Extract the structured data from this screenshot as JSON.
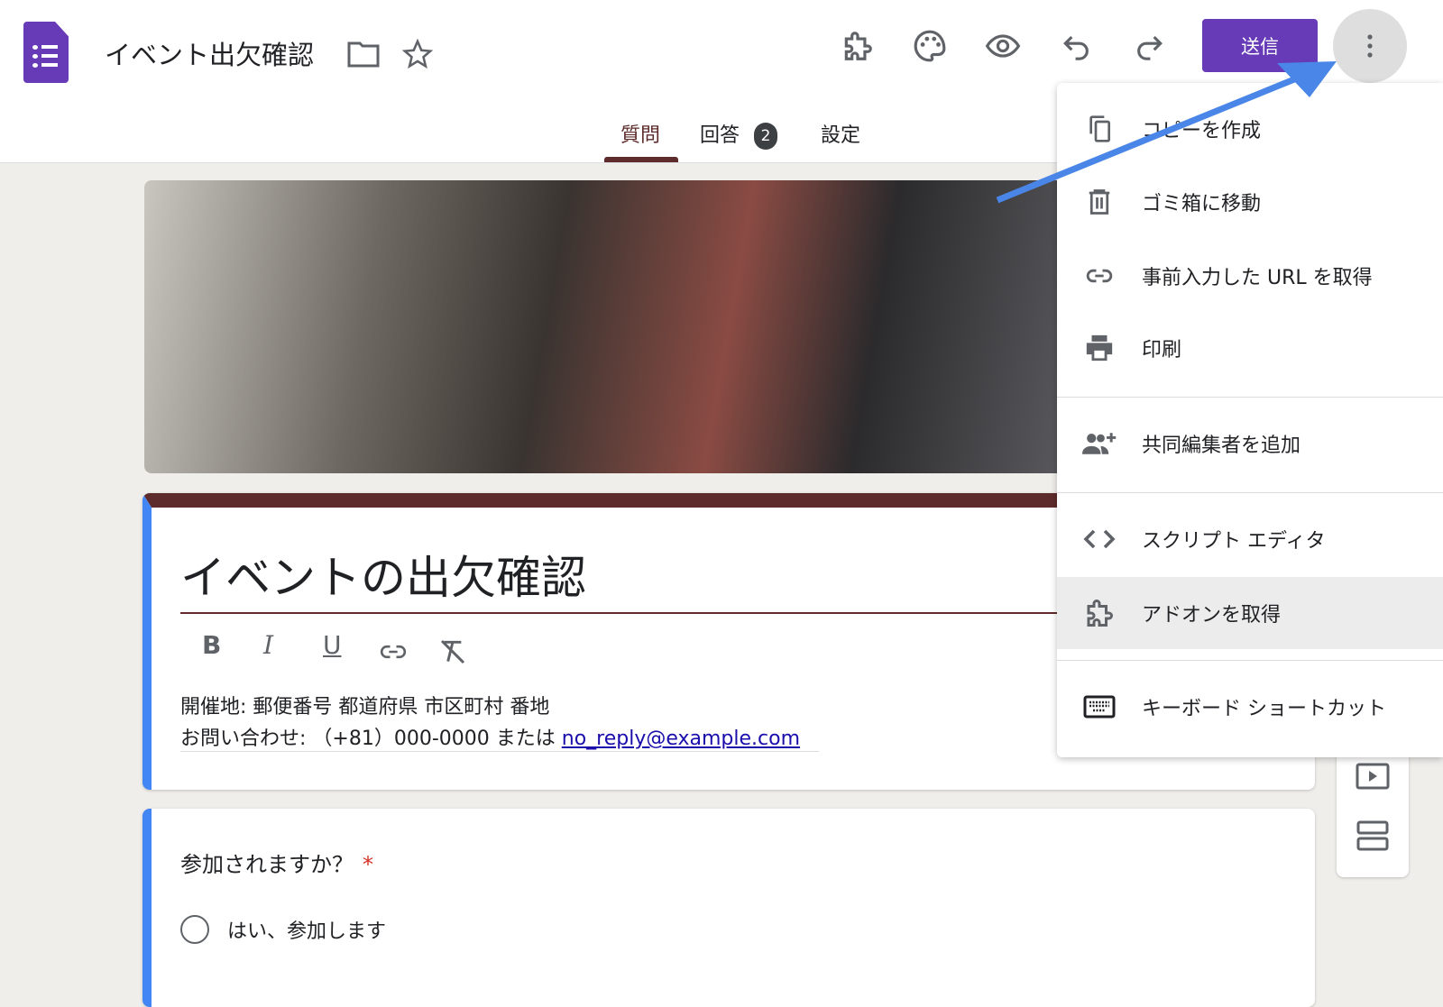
{
  "header": {
    "doc_title": "イベント出欠確認",
    "send_label": "送信"
  },
  "tabs": [
    {
      "label": "質問"
    },
    {
      "label": "回答",
      "badge": "2"
    },
    {
      "label": "設定"
    }
  ],
  "form": {
    "title": "イベントの出欠確認",
    "description_line1": "開催地: 郵便番号 都道府県 市区町村 番地",
    "description_line2": "お問い合わせ: （+81）000-0000 または ",
    "email_link": "no_reply@example.com",
    "format_buttons": [
      "B",
      "I",
      "U"
    ]
  },
  "question": {
    "text": "参加されますか？",
    "required_mark": "*",
    "options": [
      "はい、参加します"
    ]
  },
  "menu": {
    "items": [
      {
        "label": "コピーを作成",
        "icon": "copy-icon"
      },
      {
        "label": "ゴミ箱に移動",
        "icon": "trash-icon"
      },
      {
        "label": "事前入力した URL を取得",
        "icon": "link-icon"
      },
      {
        "label": "印刷",
        "icon": "print-icon"
      },
      {
        "label": "共同編集者を追加",
        "icon": "add-people-icon"
      },
      {
        "label": "スクリプト エディタ",
        "icon": "code-icon"
      },
      {
        "label": "アドオンを取得",
        "icon": "puzzle-icon"
      },
      {
        "label": "キーボード ショートカット",
        "icon": "keyboard-icon"
      }
    ]
  },
  "colors": {
    "accent": "#673ab7",
    "theme": "#5d2b2b",
    "highlight": "#4285f4",
    "arrow": "#4a86e8"
  }
}
